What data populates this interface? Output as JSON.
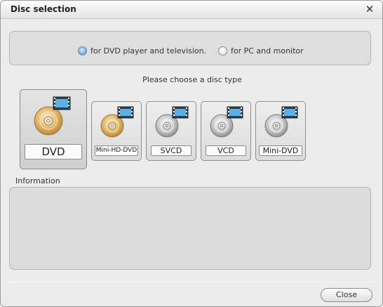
{
  "window": {
    "title": "Disc selection"
  },
  "mode": {
    "options": [
      {
        "label": "for DVD player and television.",
        "selected": true
      },
      {
        "label": "for PC and monitor",
        "selected": false
      }
    ]
  },
  "prompt": "Please choose a disc type",
  "discs": [
    {
      "label": "DVD",
      "color": "gold",
      "selected": true
    },
    {
      "label": "Mini-HD-DVD",
      "color": "gold",
      "selected": false
    },
    {
      "label": "SVCD",
      "color": "silver",
      "selected": false
    },
    {
      "label": "VCD",
      "color": "silver",
      "selected": false
    },
    {
      "label": "Mini-DVD",
      "color": "silver",
      "selected": false
    }
  ],
  "information": {
    "label": "Information",
    "text": ""
  },
  "footer": {
    "close_label": "Close"
  },
  "colors": {
    "gold_disc": "#e0b870",
    "silver_disc": "#c8c8c8",
    "film_blue": "#4aa3df",
    "radio_checked": "#5d97d3"
  }
}
